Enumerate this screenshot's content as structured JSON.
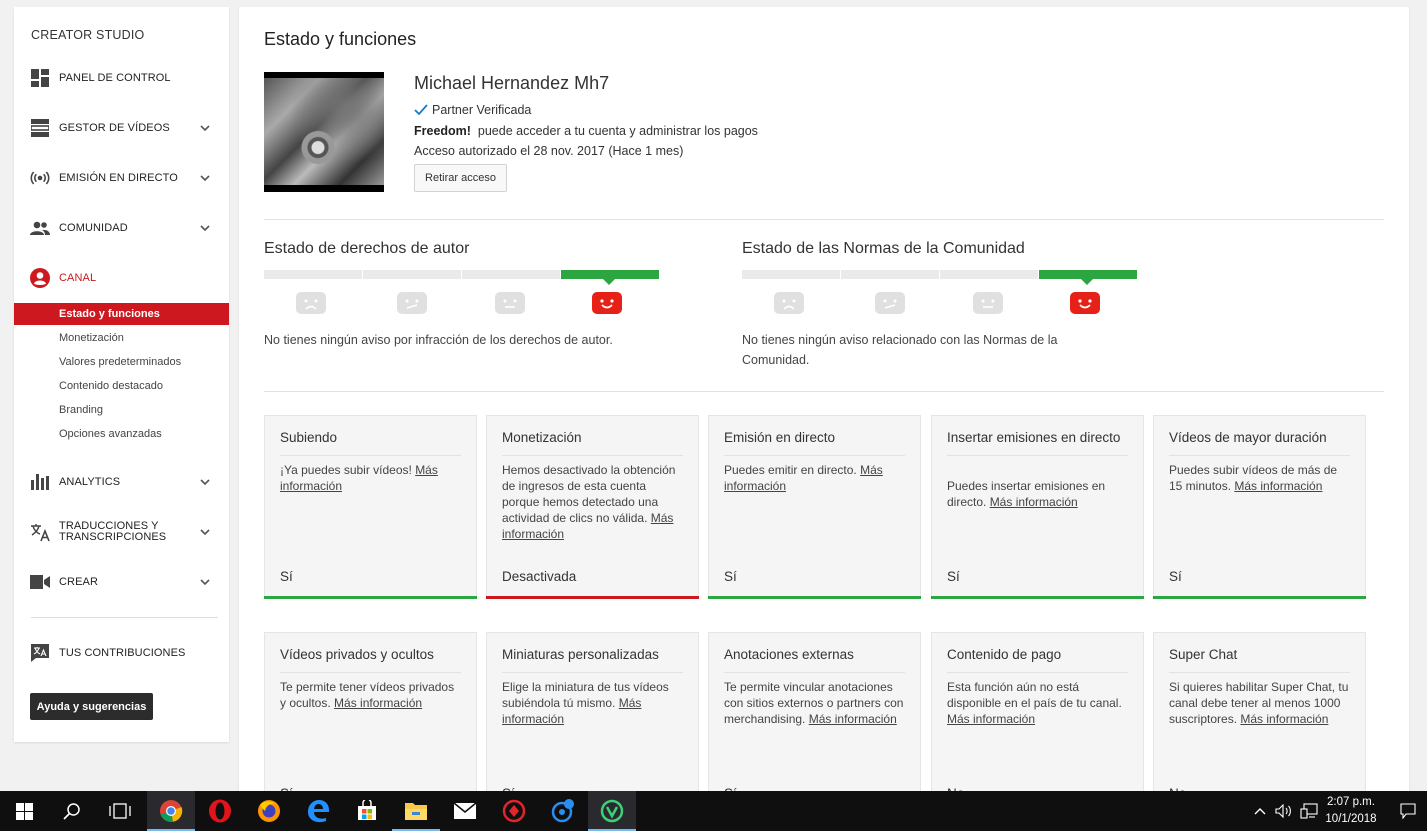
{
  "sidebar": {
    "title": "CREATOR STUDIO",
    "nav": [
      {
        "label": "PANEL DE CONTROL",
        "icon": "dashboard-icon"
      },
      {
        "label": "GESTOR DE VÍDEOS",
        "icon": "video-manager-icon"
      },
      {
        "label": "EMISIÓN EN DIRECTO",
        "icon": "live-broadcast-icon"
      },
      {
        "label": "COMUNIDAD",
        "icon": "community-icon"
      },
      {
        "label": "CANAL",
        "icon": "channel-icon"
      },
      {
        "label": "ANALYTICS",
        "icon": "analytics-icon"
      },
      {
        "label": "TRADUCCIONES Y",
        "label2": "TRANSCRIPCIONES",
        "icon": "translate-icon"
      },
      {
        "label": "CREAR",
        "icon": "camera-icon"
      }
    ],
    "channel_sub": [
      "Estado y funciones",
      "Monetización",
      "Valores predeterminados",
      "Contenido destacado",
      "Branding",
      "Opciones avanzadas"
    ],
    "contributions": "TUS CONTRIBUCIONES",
    "help_button": "Ayuda y sugerencias"
  },
  "main": {
    "title": "Estado y funciones",
    "channel_name": "Michael Hernandez Mh7",
    "partner": "Partner Verificada",
    "freedom_label": "Freedom!",
    "freedom_text": "puede acceder a tu cuenta y administrar los pagos",
    "access_text": "Acceso autorizado el 28 nov. 2017 (Hace 1 mes)",
    "revoke_button": "Retirar acceso"
  },
  "copyright": {
    "title": "Estado de derechos de autor",
    "text": "No tienes ningún aviso por infracción de los derechos de autor.",
    "level": 4
  },
  "community": {
    "title": "Estado de las Normas de la Comunidad",
    "text1": "No tienes ningún aviso relacionado con las Normas de la",
    "text2": "Comunidad.",
    "level": 4
  },
  "features_row1": [
    {
      "title": "Subiendo",
      "desc": "¡Ya puedes subir vídeos! ",
      "link": "Más información",
      "status": "Sí",
      "state": "ok"
    },
    {
      "title": "Monetización",
      "desc": "Hemos desactivado la obtención de ingresos de esta cuenta porque hemos detectado una actividad de clics no válida. ",
      "link": "Más información",
      "status": "Desactivada",
      "state": "off"
    },
    {
      "title": "Emisión en directo",
      "desc": "Puedes emitir en directo. ",
      "link": "Más información",
      "status": "Sí",
      "state": "ok"
    },
    {
      "title": "Insertar emisiones en directo",
      "desc": "Puedes insertar emisiones en directo. ",
      "link": "Más información",
      "status": "Sí",
      "state": "ok"
    },
    {
      "title": "Vídeos de mayor duración",
      "desc": "Puedes subir vídeos de más de 15 minutos. ",
      "link": "Más información",
      "status": "Sí",
      "state": "ok"
    }
  ],
  "features_row2": [
    {
      "title": "Vídeos privados y ocultos",
      "desc": "Te permite tener vídeos privados y ocultos. ",
      "link": "Más información",
      "status": "Sí"
    },
    {
      "title": "Miniaturas personalizadas",
      "desc": "Elige la miniatura de tus vídeos subiéndola tú mismo. ",
      "link": "Más información",
      "status": "Sí"
    },
    {
      "title": "Anotaciones externas",
      "desc": "Te permite vincular anotaciones con sitios externos o partners con merchandising. ",
      "link": "Más información",
      "status": "Sí"
    },
    {
      "title": "Contenido de pago",
      "desc": "Esta función aún no está disponible en el país de tu canal. ",
      "link": "Más información",
      "status": "No"
    },
    {
      "title": "Super Chat",
      "desc": "Si quieres habilitar Super Chat, tu canal debe tener al menos 1000 suscriptores. ",
      "link": "Más información",
      "status": "No"
    }
  ],
  "colors": {
    "ok": "#2ba640",
    "off": "#cc181e",
    "red": "#e62117",
    "gray_face": "#e0e0e0"
  },
  "taskbar": {
    "icons": [
      "windows-start-icon",
      "search-icon",
      "task-view-icon",
      "chrome-icon",
      "opera-icon",
      "firefox-icon",
      "edge-icon",
      "store-icon",
      "file-explorer-icon",
      "mail-icon",
      "app-red-icon",
      "app-blue-icon",
      "app-green-icon"
    ],
    "time": "2:07 p.m.",
    "date": "10/1/2018"
  }
}
